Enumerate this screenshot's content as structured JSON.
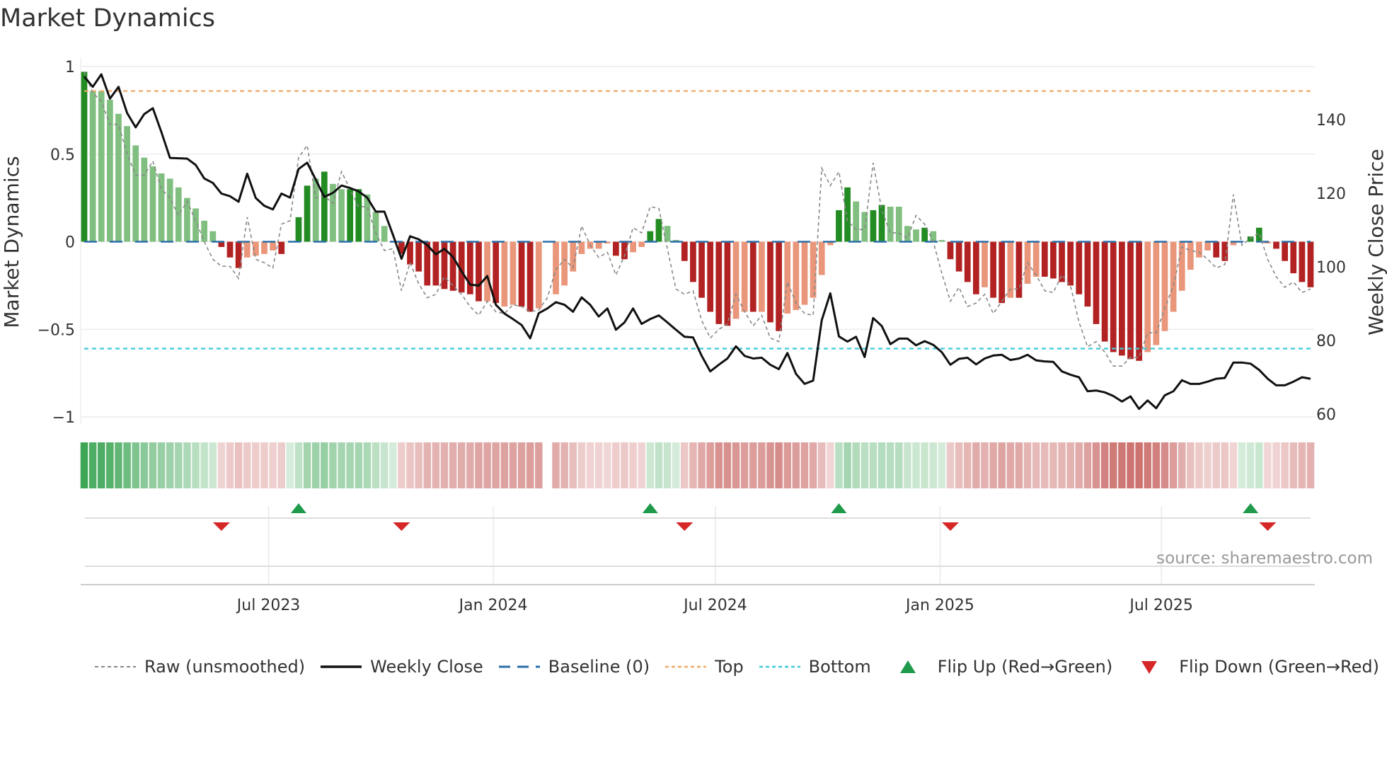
{
  "title": "Market Dynamics",
  "source": "source: sharemaestro.com",
  "colors": {
    "green_strong": "#228b22",
    "green_weak": "#80bf80",
    "red_strong": "#b22222",
    "red_weak": "#e9967a",
    "price": "#111111",
    "raw": "#888888",
    "baseline": "#2a6fa8",
    "top": "#f0a868",
    "bottom": "#3ccbd8",
    "flip_up": "#1f9a4a",
    "flip_down": "#d62728"
  },
  "chart_data": {
    "type": "bar",
    "title": "Market Dynamics",
    "ylabel": "Market Dynamics",
    "y2label": "Weekly Close Price",
    "ylim": [
      -1,
      1
    ],
    "y2lim": [
      60,
      140
    ],
    "yticks": [
      "1",
      "0.5",
      "0",
      "−0.5",
      "−1"
    ],
    "yticks_values": [
      1,
      0.5,
      0,
      -0.5,
      -1
    ],
    "y2ticks": [
      "140",
      "120",
      "100",
      "80",
      "60"
    ],
    "y2ticks_values": [
      140,
      120,
      100,
      80,
      60
    ],
    "x_ticks": [
      {
        "label": "Jul 2023",
        "week": 21.5
      },
      {
        "label": "Jan 2024",
        "week": 47.7
      },
      {
        "label": "Jul 2024",
        "week": 73.6
      },
      {
        "label": "Jan 2025",
        "week": 99.8
      },
      {
        "label": "Jul 2025",
        "week": 125.6
      }
    ],
    "top_level": 0.86,
    "bottom_level": -0.61,
    "baseline": 0,
    "momentum": [
      0.97,
      0.86,
      0.86,
      0.81,
      0.73,
      0.66,
      0.55,
      0.48,
      0.43,
      0.39,
      0.36,
      0.31,
      0.25,
      0.19,
      0.12,
      0.06,
      -0.03,
      -0.09,
      -0.15,
      -0.09,
      -0.08,
      -0.07,
      -0.05,
      -0.07,
      0.0,
      0.14,
      0.32,
      0.36,
      0.4,
      0.33,
      0.3,
      0.3,
      0.3,
      0.27,
      0.17,
      0.09,
      0.0,
      -0.07,
      -0.13,
      -0.17,
      -0.25,
      -0.25,
      -0.27,
      -0.28,
      -0.29,
      -0.3,
      -0.34,
      -0.34,
      -0.35,
      -0.37,
      -0.36,
      -0.37,
      -0.4,
      -0.38,
      null,
      -0.3,
      -0.25,
      -0.17,
      -0.07,
      -0.04,
      -0.04,
      -0.01,
      -0.08,
      -0.1,
      -0.06,
      -0.03,
      0.06,
      0.13,
      0.09,
      0.01,
      -0.11,
      -0.23,
      -0.32,
      -0.4,
      -0.47,
      -0.48,
      -0.44,
      -0.4,
      -0.4,
      -0.4,
      -0.46,
      -0.51,
      -0.41,
      -0.39,
      -0.36,
      -0.32,
      -0.19,
      -0.02,
      0.18,
      0.31,
      0.23,
      0.17,
      0.18,
      0.21,
      0.2,
      0.2,
      0.09,
      0.07,
      0.08,
      0.06,
      0.01,
      -0.1,
      -0.17,
      -0.23,
      -0.3,
      -0.26,
      -0.32,
      -0.35,
      -0.32,
      -0.32,
      -0.24,
      -0.2,
      -0.2,
      -0.21,
      -0.23,
      -0.25,
      -0.3,
      -0.37,
      -0.47,
      -0.57,
      -0.63,
      -0.65,
      -0.67,
      -0.68,
      -0.63,
      -0.59,
      -0.51,
      -0.4,
      -0.28,
      -0.16,
      -0.09,
      -0.05,
      -0.09,
      -0.11,
      -0.02,
      0.0,
      0.03,
      0.08,
      -0.01,
      -0.04,
      -0.11,
      -0.18,
      -0.23,
      -0.26
    ],
    "strength": [
      "s",
      "w",
      "w",
      "w",
      "w",
      "w",
      "w",
      "w",
      "w",
      "w",
      "w",
      "w",
      "w",
      "w",
      "w",
      "w",
      "s",
      "s",
      "s",
      "w",
      "w",
      "w",
      "w",
      "s",
      "w",
      "s",
      "s",
      "w",
      "s",
      "w",
      "w",
      "s",
      "s",
      "w",
      "w",
      "w",
      "w",
      "s",
      "s",
      "s",
      "s",
      "s",
      "s",
      "s",
      "s",
      "s",
      "s",
      "w",
      "s",
      "w",
      "w",
      "s",
      "s",
      "w",
      "w",
      "w",
      "w",
      "w",
      "w",
      "w",
      "w",
      "w",
      "s",
      "s",
      "w",
      "w",
      "s",
      "s",
      "w",
      "w",
      "s",
      "s",
      "s",
      "s",
      "s",
      "s",
      "w",
      "w",
      "s",
      "w",
      "s",
      "s",
      "w",
      "w",
      "w",
      "w",
      "w",
      "w",
      "s",
      "s",
      "w",
      "w",
      "s",
      "s",
      "w",
      "w",
      "w",
      "w",
      "s",
      "w",
      "w",
      "s",
      "s",
      "s",
      "s",
      "w",
      "s",
      "s",
      "w",
      "s",
      "w",
      "w",
      "s",
      "s",
      "s",
      "s",
      "s",
      "s",
      "s",
      "s",
      "s",
      "s",
      "s",
      "s",
      "w",
      "w",
      "w",
      "w",
      "w",
      "w",
      "w",
      "w",
      "s",
      "s",
      "w",
      "w",
      "s",
      "s",
      "w",
      "s",
      "s",
      "s",
      "s",
      "s"
    ],
    "raw": [
      0.97,
      0.85,
      0.8,
      0.67,
      0.67,
      0.5,
      0.38,
      0.38,
      0.46,
      0.3,
      0.25,
      0.15,
      0.23,
      0.12,
      0.0,
      -0.1,
      -0.14,
      -0.14,
      -0.21,
      0.14,
      -0.1,
      -0.12,
      -0.15,
      0.1,
      0.12,
      0.48,
      0.55,
      0.25,
      0.26,
      0.22,
      0.4,
      0.3,
      0.2,
      0.2,
      0.05,
      -0.05,
      -0.04,
      -0.28,
      -0.12,
      -0.24,
      -0.32,
      -0.3,
      -0.2,
      -0.25,
      -0.3,
      -0.37,
      -0.42,
      -0.34,
      -0.4,
      -0.41,
      -0.36,
      -0.37,
      -0.4,
      -0.39,
      -0.32,
      -0.16,
      -0.1,
      -0.15,
      0.09,
      -0.02,
      -0.09,
      -0.06,
      -0.19,
      -0.08,
      0.08,
      0.05,
      0.2,
      0.19,
      -0.04,
      -0.27,
      -0.3,
      -0.28,
      -0.45,
      -0.55,
      -0.5,
      -0.47,
      -0.3,
      -0.4,
      -0.48,
      -0.42,
      -0.55,
      -0.57,
      -0.23,
      -0.35,
      -0.41,
      -0.42,
      0.42,
      0.32,
      0.4,
      0.12,
      0.07,
      0.07,
      0.45,
      0.18,
      0.05,
      0.05,
      0.02,
      0.15,
      0.1,
      0.0,
      -0.18,
      -0.34,
      -0.26,
      -0.37,
      -0.35,
      -0.3,
      -0.41,
      -0.34,
      -0.27,
      -0.27,
      -0.12,
      -0.19,
      -0.28,
      -0.29,
      -0.19,
      -0.25,
      -0.46,
      -0.6,
      -0.57,
      -0.63,
      -0.71,
      -0.71,
      -0.66,
      -0.66,
      -0.52,
      -0.52,
      -0.38,
      -0.25,
      -0.03,
      -0.05,
      -0.06,
      -0.1,
      -0.15,
      -0.13,
      0.27,
      -0.02,
      0.02,
      0.05,
      -0.1,
      -0.2,
      -0.26,
      -0.23,
      -0.29,
      -0.27
    ],
    "weekly_close": [
      151.7,
      148.9,
      152.3,
      145.7,
      148.9,
      141.8,
      137.9,
      141.5,
      143.1,
      136.6,
      129.6,
      129.5,
      129.4,
      127.7,
      124.0,
      122.8,
      119.9,
      119.2,
      117.7,
      125.3,
      118.7,
      116.6,
      115.6,
      119.9,
      118.8,
      126.6,
      128.3,
      123.7,
      119.0,
      120.1,
      122.1,
      121.4,
      120.5,
      118.8,
      115.0,
      115.0,
      108.7,
      102.2,
      108.3,
      107.5,
      105.9,
      103.4,
      104.9,
      102.7,
      98.8,
      95.2,
      94.9,
      97.5,
      89.7,
      87.3,
      85.8,
      84.2,
      80.6,
      87.4,
      88.7,
      90.4,
      89.7,
      87.8,
      91.7,
      89.7,
      86.5,
      88.7,
      82.9,
      84.9,
      88.7,
      84.5,
      85.8,
      86.8,
      84.9,
      82.9,
      81.0,
      80.8,
      75.8,
      71.6,
      73.4,
      75.1,
      78.4,
      75.8,
      75.1,
      75.3,
      73.4,
      72.2,
      76.6,
      70.9,
      68.2,
      69.1,
      85.5,
      92.8,
      81.1,
      79.7,
      81.0,
      75.5,
      86.1,
      83.9,
      79.0,
      80.5,
      80.5,
      78.7,
      79.8,
      78.8,
      76.8,
      73.4,
      75.0,
      75.3,
      73.5,
      75.1,
      75.9,
      76.1,
      74.7,
      75.1,
      76.1,
      74.6,
      74.3,
      74.2,
      71.6,
      70.7,
      70.0,
      66.2,
      66.4,
      65.9,
      64.9,
      63.4,
      64.8,
      61.4,
      63.7,
      61.6,
      65.1,
      66.2,
      69.2,
      68.2,
      68.2,
      68.8,
      69.6,
      69.8,
      74.0,
      74.0,
      73.7,
      72.0,
      69.6,
      67.8,
      67.8,
      68.8,
      70.0,
      69.6
    ],
    "flip_up_weeks": [
      25,
      66,
      88,
      136
    ],
    "flip_down_weeks": [
      16,
      37,
      70,
      101,
      138
    ],
    "legend": [
      "Raw (unsmoothed)",
      "Weekly Close",
      "Baseline (0)",
      "Top",
      "Bottom",
      "Flip Up (Red→Green)",
      "Flip Down (Green→Red)"
    ],
    "legend_placement": "bottom"
  }
}
